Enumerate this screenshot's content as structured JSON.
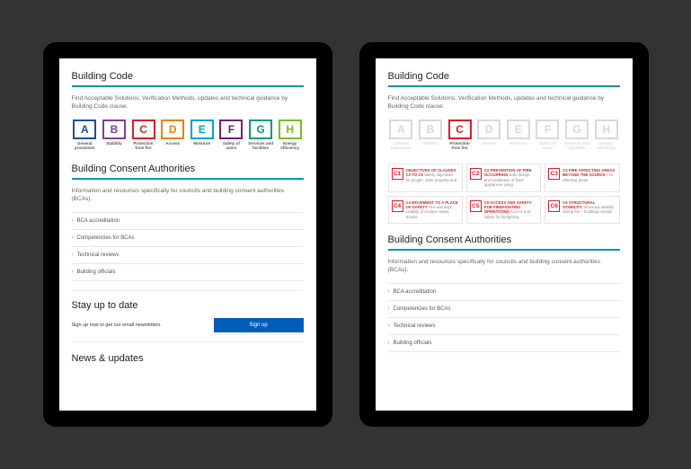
{
  "left": {
    "section1_title": "Building Code",
    "section1_intro": "Find Acceptable Solutions, Verification Methods, updates and technical guidance by Building Code clause.",
    "tiles": [
      {
        "letter": "A",
        "label": "General provisions"
      },
      {
        "letter": "B",
        "label": "Stability"
      },
      {
        "letter": "C",
        "label": "Protection from fire"
      },
      {
        "letter": "D",
        "label": "Access"
      },
      {
        "letter": "E",
        "label": "Moisture"
      },
      {
        "letter": "F",
        "label": "Safety of users"
      },
      {
        "letter": "G",
        "label": "Services and facilities"
      },
      {
        "letter": "H",
        "label": "Energy efficiency"
      }
    ],
    "section2_title": "Building Consent Authorities",
    "section2_intro": "Information and resources specifically for councils and building consent authorities (BCAs).",
    "links": [
      "BCA accreditation",
      "Competencies for BCAs",
      "Technical reviews",
      "Building officials"
    ],
    "stayup_title": "Stay up to date",
    "stayup_text": "Sign up now to get our email newsletters",
    "stayup_button": "Sign up",
    "news_title": "News & updates"
  },
  "right": {
    "section1_title": "Building Code",
    "section1_intro": "Find Acceptable Solutions, Verification Methods, updates and technical guidance by Building Code clause.",
    "tiles": [
      {
        "letter": "A",
        "label": "General provisions"
      },
      {
        "letter": "B",
        "label": "Stability"
      },
      {
        "letter": "C",
        "label": "Protection from fire"
      },
      {
        "letter": "D",
        "label": "Access"
      },
      {
        "letter": "E",
        "label": "Moisture"
      },
      {
        "letter": "F",
        "label": "Safety of users"
      },
      {
        "letter": "G",
        "label": "Services and facilities"
      },
      {
        "letter": "H",
        "label": "Energy efficiency"
      }
    ],
    "active_tile": "C",
    "subtiles": [
      {
        "code": "C1",
        "title": "Objectives of clauses C2 to C6",
        "desc": "Safety objectives for people, other property and"
      },
      {
        "code": "C2",
        "title": "C2 Prevention of fire occurring",
        "desc": "Safe design and installation of fixed appliances using"
      },
      {
        "code": "C3",
        "title": "C3 Fire affecting areas beyond the source",
        "desc": "Fire affecting areas"
      },
      {
        "code": "C4",
        "title": "C4 Movement to a place of safety",
        "desc": "Fire warnings, visibility of escape routes, Smoke"
      },
      {
        "code": "C5",
        "title": "C5 Access and safety for firefighting operations",
        "desc": "Access and safety for firefighting"
      },
      {
        "code": "C6",
        "title": "C6 Structural stability",
        "desc": "Structural stability during fire – buildings remain"
      }
    ],
    "section2_title": "Building Consent Authorities",
    "section2_intro": "Information and resources specifically for councils and building consent authorities (BCAs).",
    "links": [
      "BCA accreditation",
      "Competencies for BCAs",
      "Technical reviews",
      "Building officials"
    ]
  }
}
